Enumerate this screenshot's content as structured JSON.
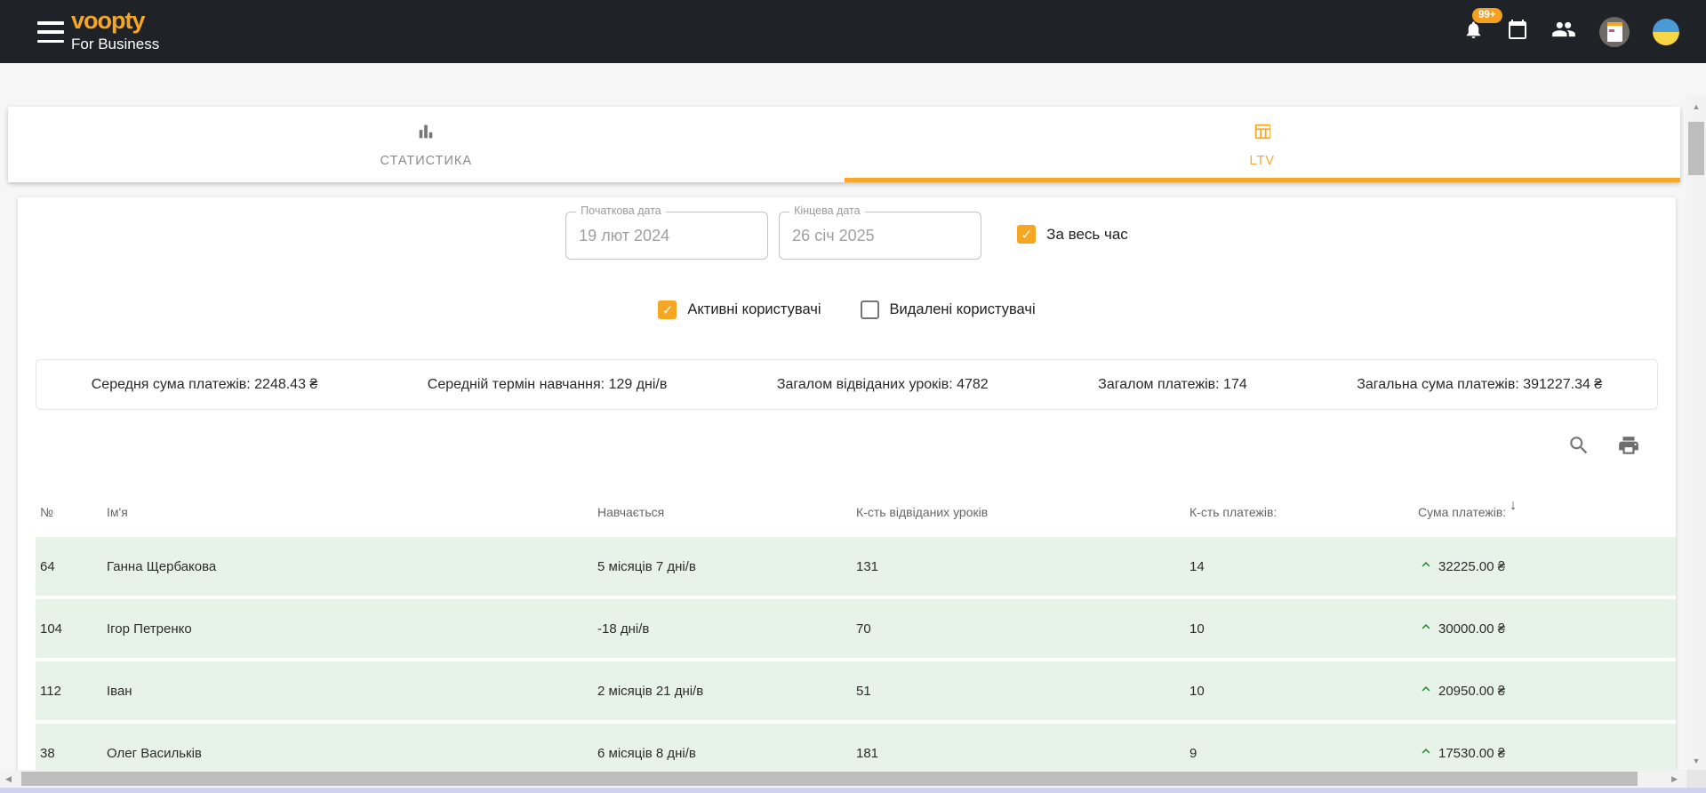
{
  "header": {
    "logo": "voopty",
    "logo_sub": "For Business",
    "notification_badge": "99+"
  },
  "tabs": [
    {
      "label": "СТАТИСТИКА",
      "active": false
    },
    {
      "label": "LTV",
      "active": true
    }
  ],
  "filters": {
    "start_date": {
      "label": "Початкова дата",
      "value": "19 лют 2024"
    },
    "end_date": {
      "label": "Кінцева дата",
      "value": "26 січ 2025"
    },
    "all_time": {
      "label": "За весь час",
      "checked": true
    },
    "active_users": {
      "label": "Активні користувачі",
      "checked": true
    },
    "deleted_users": {
      "label": "Видалені користувачі",
      "checked": false
    }
  },
  "summary": [
    "Середня сума платежів: 2248.43 ₴",
    "Середній термін навчання: 129 дні/в",
    "Загалом відвіданих уроків: 4782",
    "Загалом платежів: 174",
    "Загальна сума платежів: 391227.34 ₴"
  ],
  "table": {
    "columns": [
      "№",
      "Ім'я",
      "Навчається",
      "К-сть відвіданих уроків",
      "К-сть платежів:",
      "Сума платежів:"
    ],
    "rows": [
      {
        "num": "64",
        "name": "Ганна Щербакова",
        "duration": "5 місяців 7 дні/в",
        "lessons": "131",
        "payments": "14",
        "sum": "32225.00 ₴"
      },
      {
        "num": "104",
        "name": "Ігор Петренко",
        "duration": "-18 дні/в",
        "lessons": "70",
        "payments": "10",
        "sum": "30000.00 ₴"
      },
      {
        "num": "112",
        "name": "Іван",
        "duration": "2 місяців 21 дні/в",
        "lessons": "51",
        "payments": "10",
        "sum": "20950.00 ₴"
      },
      {
        "num": "38",
        "name": "Олег Васильків",
        "duration": "6 місяців 8 дні/в",
        "lessons": "181",
        "payments": "9",
        "sum": "17530.00 ₴"
      }
    ]
  },
  "icons": {
    "sort_desc": "↓",
    "scroll_up": "▲",
    "scroll_down": "▼",
    "scroll_left": "◀",
    "scroll_right": "▶"
  },
  "colors": {
    "accent_orange": "#F5A623",
    "tab_active": "#F9A825",
    "row_green": "#E7F3E8",
    "trend_green": "#1B8A24",
    "header_dark": "#1F2227",
    "flag_blue": "#4A9AD8",
    "flag_yellow": "#F7D646"
  }
}
